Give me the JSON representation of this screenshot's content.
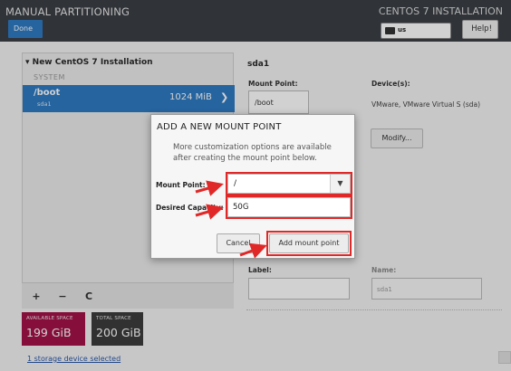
{
  "header": {
    "app_title": "MANUAL PARTITIONING",
    "done_label": "Done",
    "install_title": "CENTOS 7 INSTALLATION",
    "keyboard_layout": "us",
    "help_label": "Help!"
  },
  "left_panel": {
    "install_header": "New CentOS 7 Installation",
    "system_label": "SYSTEM",
    "boot": {
      "mount": "/boot",
      "device": "sda1",
      "size": "1024 MiB"
    },
    "toolbar": {
      "add": "+",
      "remove": "−",
      "refresh": "C"
    }
  },
  "space": {
    "available_label": "AVAILABLE SPACE",
    "available_value": "199 GiB",
    "total_label": "TOTAL SPACE",
    "total_value": "200 GiB"
  },
  "storage_link": "1 storage device selected",
  "right_panel": {
    "title": "sda1",
    "mount_point_label": "Mount Point:",
    "mount_point_value": "/boot",
    "devices_label": "Device(s):",
    "devices_text": "VMware, VMware Virtual S (sda)",
    "modify_label": "Modify...",
    "label_label": "Label:",
    "name_label": "Name:",
    "name_value": "sda1"
  },
  "dialog": {
    "title": "ADD A NEW MOUNT POINT",
    "description": "More customization options are available after creating the mount point below.",
    "mount_point_label": "Mount Point:",
    "mount_point_value": "/",
    "capacity_label": "Desired Capacity:",
    "capacity_value": "50G",
    "cancel_label": "Cancel",
    "add_label": "Add mount point"
  },
  "colors": {
    "header_bg": "#3b3f45",
    "accent_blue": "#2f7bc2",
    "available_tile": "#a31347",
    "total_tile": "#3c3c3c",
    "annotation_red": "#e02828"
  },
  "icons": {
    "keyboard": "keyboard-icon",
    "chevron": "chevron-right-icon",
    "dropdown": "dropdown-arrow-icon",
    "refresh": "refresh-icon"
  }
}
